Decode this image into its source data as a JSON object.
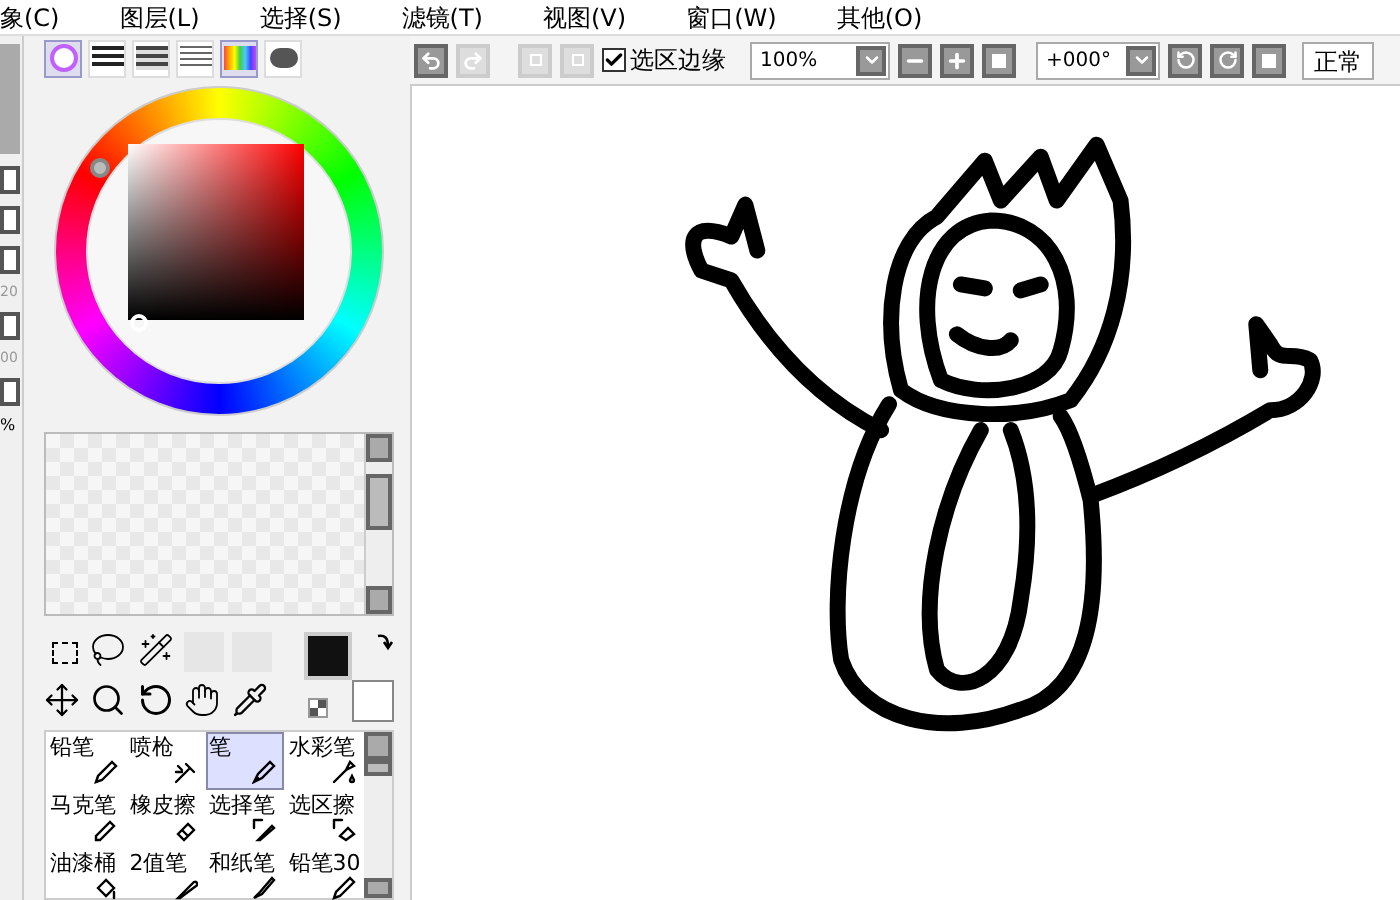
{
  "menu": [
    {
      "label": "象(C)"
    },
    {
      "label": "图层(L)"
    },
    {
      "label": "选择(S)"
    },
    {
      "label": "滤镜(T)"
    },
    {
      "label": "视图(V)"
    },
    {
      "label": "窗口(W)"
    },
    {
      "label": "其他(O)"
    }
  ],
  "color_modes": [
    {
      "kind": "wheel",
      "selected": true
    },
    {
      "kind": "bars",
      "selected": false
    },
    {
      "kind": "bars2",
      "selected": false
    },
    {
      "kind": "lines",
      "selected": false
    },
    {
      "kind": "grid",
      "selected": true
    },
    {
      "kind": "scratch",
      "selected": false
    }
  ],
  "left_strip": {
    "texts": [
      "20",
      "00",
      "%"
    ]
  },
  "toolbar": {
    "selection_edge": {
      "label": "选区边缘",
      "checked": true
    },
    "zoom": "100%",
    "rotation": "+000°",
    "blend_mode": "正常"
  },
  "brushes": [
    {
      "label": "铅笔",
      "kind": "pencil",
      "selected": false
    },
    {
      "label": "喷枪",
      "kind": "airbrush",
      "selected": false
    },
    {
      "label": "笔",
      "kind": "pen",
      "selected": true
    },
    {
      "label": "水彩笔",
      "kind": "watercolor",
      "selected": false
    },
    {
      "label": "马克笔",
      "kind": "marker",
      "selected": false
    },
    {
      "label": "橡皮擦",
      "kind": "eraser",
      "selected": false
    },
    {
      "label": "选择笔",
      "kind": "selpen",
      "selected": false
    },
    {
      "label": "选区擦",
      "kind": "selerase",
      "selected": false
    },
    {
      "label": "油漆桶",
      "kind": "bucket",
      "selected": false
    },
    {
      "label": "2值笔",
      "kind": "binary",
      "selected": false
    },
    {
      "label": "和纸笔",
      "kind": "washi",
      "selected": false
    },
    {
      "label": "铅笔30",
      "kind": "pencil",
      "selected": false
    }
  ]
}
